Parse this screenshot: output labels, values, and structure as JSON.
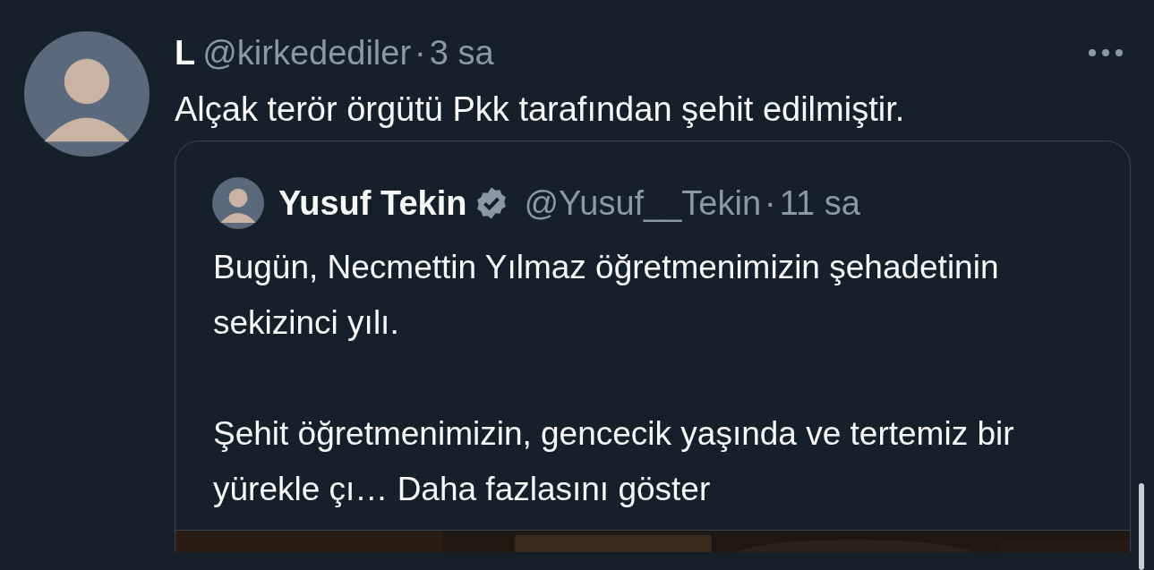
{
  "tweet": {
    "display_name": "L",
    "handle": "@kirkedediler",
    "separator": "·",
    "time": "3 sa",
    "text": "Alçak terör örgütü Pkk tarafından şehit edilmiştir.",
    "quote": {
      "display_name": "Yusuf Tekin",
      "verified": true,
      "handle": "@Yusuf__Tekin",
      "separator": "·",
      "time": "11 sa",
      "paragraphs": [
        "Bugün, Necmettin Yılmaz öğretmenimizin şehadetinin sekizinci yılı.",
        "Şehit öğretmenimizin, gencecik yaşında ve tertemiz bir yürekle çı…"
      ],
      "show_more": "Daha fazlasını göster"
    }
  }
}
